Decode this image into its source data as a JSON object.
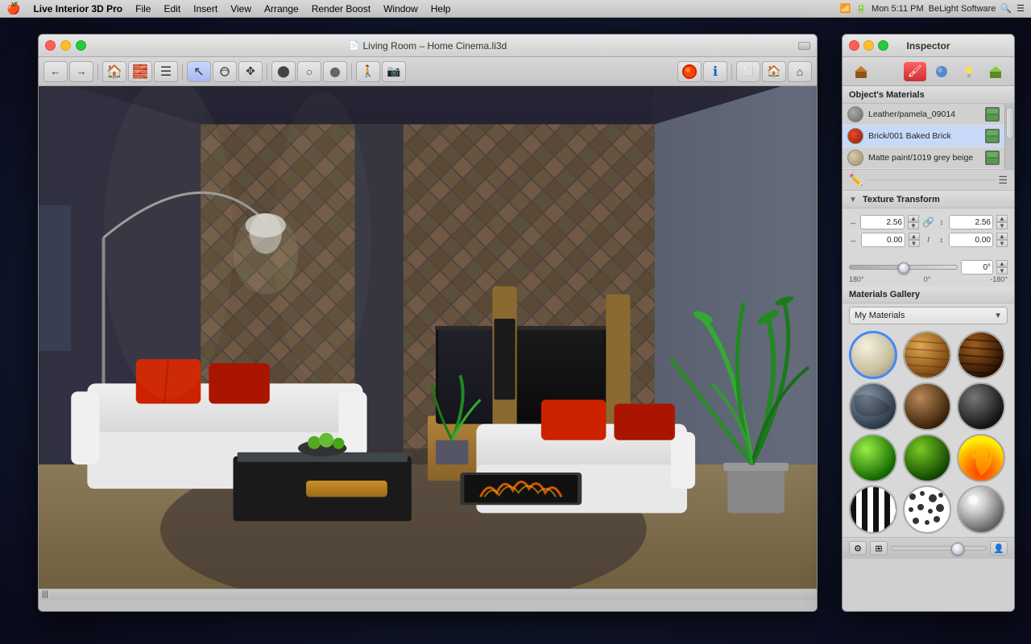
{
  "menubar": {
    "apple": "🍎",
    "items": [
      {
        "label": "Live Interior 3D Pro",
        "bold": true
      },
      {
        "label": "File"
      },
      {
        "label": "Edit"
      },
      {
        "label": "Insert"
      },
      {
        "label": "View"
      },
      {
        "label": "Arrange"
      },
      {
        "label": "Render Boost"
      },
      {
        "label": "Window"
      },
      {
        "label": "Help"
      }
    ],
    "right": {
      "datetime": "Mon 5:11 PM",
      "company": "BeLight Software",
      "search_icon": "🔍",
      "menu_icon": "☰"
    }
  },
  "main_window": {
    "title": "Living Room – Home Cinema.li3d",
    "title_icon": "📄",
    "statusbar_text": "|||"
  },
  "toolbar": {
    "nav_back": "←",
    "nav_forward": "→",
    "btn_floor": "🏠",
    "btn_wall": "🧱",
    "btn_list": "☰",
    "btn_select": "↖",
    "btn_orbit": "⟳",
    "btn_pan": "✥",
    "btn_sphere": "⬤",
    "btn_circle": "○",
    "btn_camera": "⬤",
    "btn_walk": "🚶",
    "btn_photo": "📷",
    "btn_info": "ℹ",
    "btn_view1": "⬜",
    "btn_view2": "🏠",
    "btn_view3": "⌂"
  },
  "inspector": {
    "title": "Inspector",
    "tabs": [
      {
        "icon": "🏠",
        "type": "home",
        "active": false
      },
      {
        "icon": "⬤",
        "type": "sphere",
        "active": false
      },
      {
        "icon": "🖌",
        "type": "paint",
        "active": true
      },
      {
        "icon": "💧",
        "type": "material",
        "active": false
      },
      {
        "icon": "💡",
        "type": "light",
        "active": false
      },
      {
        "icon": "🏠",
        "type": "scene",
        "active": false
      }
    ],
    "tl_red": "red",
    "tl_yellow": "yellow",
    "tl_green": "green",
    "object_materials_title": "Object's Materials",
    "materials": [
      {
        "name": "Leather/pamela_09014",
        "color": "#888888",
        "selected": false
      },
      {
        "name": "Brick/001 Baked Brick",
        "color": "#cc3322",
        "selected": true
      },
      {
        "name": "Matte paint/1019 grey beige",
        "color": "#c8b89a",
        "selected": false
      }
    ],
    "texture_transform_title": "Texture Transform",
    "tx_width_label": "↔",
    "tx_height_label": "↕",
    "tx_x_label": "↔",
    "tx_y_label": "↕",
    "tx_w_value": "2.56",
    "tx_h_value": "2.56",
    "tx_x_value": "0.00",
    "tx_y_value": "0.00",
    "tx_angle_value": "0°",
    "slider_min": "180°",
    "slider_mid": "0°",
    "slider_max": "-180°",
    "materials_gallery_title": "Materials Gallery",
    "gallery_dropdown": "My Materials",
    "gallery_items": [
      {
        "id": 1,
        "type": "beige",
        "selected": true
      },
      {
        "id": 2,
        "type": "wood1",
        "selected": false
      },
      {
        "id": 3,
        "type": "wood-dark",
        "selected": false
      },
      {
        "id": 4,
        "type": "stone",
        "selected": false
      },
      {
        "id": 5,
        "type": "brown-sphere",
        "selected": false
      },
      {
        "id": 6,
        "type": "dark-sphere",
        "selected": false
      },
      {
        "id": 7,
        "type": "green1",
        "selected": false
      },
      {
        "id": 8,
        "type": "green2",
        "selected": false
      },
      {
        "id": 9,
        "type": "fire",
        "selected": false
      },
      {
        "id": 10,
        "type": "zebra",
        "selected": false
      },
      {
        "id": 11,
        "type": "dalmatian",
        "selected": false
      },
      {
        "id": 12,
        "type": "silver",
        "selected": false
      }
    ]
  }
}
